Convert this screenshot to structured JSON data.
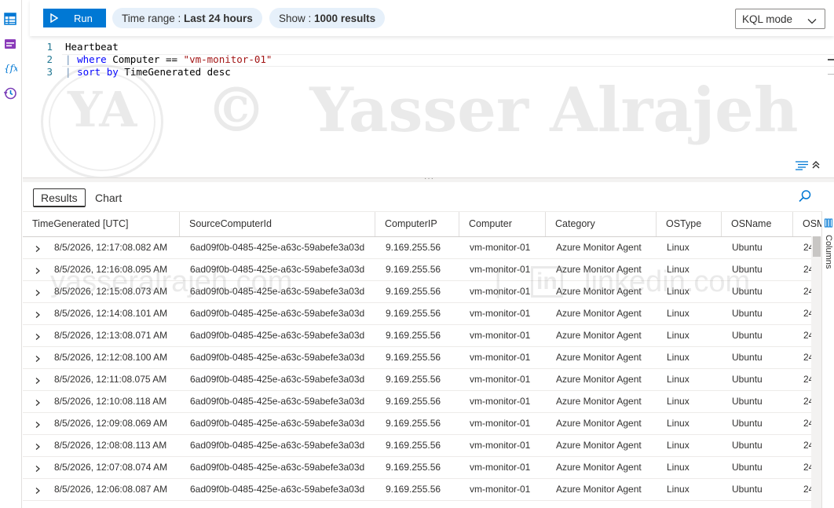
{
  "toolbar": {
    "run_label": "Run",
    "time_range_label": "Time range : ",
    "time_range_value": "Last 24 hours",
    "show_label": "Show : ",
    "show_value": "1000 results",
    "mode_label": "KQL mode"
  },
  "editor": {
    "lines": [
      {
        "num": "1",
        "text": "Heartbeat"
      },
      {
        "num": "2",
        "bar": "|",
        "kw": "where",
        "mid": " Computer == ",
        "str": "\"vm-monitor-01\""
      },
      {
        "num": "3",
        "bar": "|",
        "kw": "sort",
        "mid": " ",
        "kw2": "by",
        "rest": " TimeGenerated desc"
      }
    ]
  },
  "watermark": {
    "monogram": "YA",
    "text": "©  Yasser Alrajeh",
    "site": "yasseralrajeh.com",
    "linkedin": "linkedin.com",
    "in": "in"
  },
  "results": {
    "tabs": [
      "Results",
      "Chart"
    ],
    "columns_label": "Columns",
    "columns": [
      "TimeGenerated [UTC]",
      "SourceComputerId",
      "ComputerIP",
      "Computer",
      "Category",
      "OSType",
      "OSName",
      "OSM"
    ],
    "rows": [
      [
        "8/5/2026, 12:17:08.082 AM",
        "6ad09f0b-0485-425e-a63c-59abefe3a03d",
        "9.169.255.56",
        "vm-monitor-01",
        "Azure Monitor Agent",
        "Linux",
        "Ubuntu",
        "24"
      ],
      [
        "8/5/2026, 12:16:08.095 AM",
        "6ad09f0b-0485-425e-a63c-59abefe3a03d",
        "9.169.255.56",
        "vm-monitor-01",
        "Azure Monitor Agent",
        "Linux",
        "Ubuntu",
        "24"
      ],
      [
        "8/5/2026, 12:15:08.073 AM",
        "6ad09f0b-0485-425e-a63c-59abefe3a03d",
        "9.169.255.56",
        "vm-monitor-01",
        "Azure Monitor Agent",
        "Linux",
        "Ubuntu",
        "24"
      ],
      [
        "8/5/2026, 12:14:08.101 AM",
        "6ad09f0b-0485-425e-a63c-59abefe3a03d",
        "9.169.255.56",
        "vm-monitor-01",
        "Azure Monitor Agent",
        "Linux",
        "Ubuntu",
        "24"
      ],
      [
        "8/5/2026, 12:13:08.071 AM",
        "6ad09f0b-0485-425e-a63c-59abefe3a03d",
        "9.169.255.56",
        "vm-monitor-01",
        "Azure Monitor Agent",
        "Linux",
        "Ubuntu",
        "24"
      ],
      [
        "8/5/2026, 12:12:08.100 AM",
        "6ad09f0b-0485-425e-a63c-59abefe3a03d",
        "9.169.255.56",
        "vm-monitor-01",
        "Azure Monitor Agent",
        "Linux",
        "Ubuntu",
        "24"
      ],
      [
        "8/5/2026, 12:11:08.075 AM",
        "6ad09f0b-0485-425e-a63c-59abefe3a03d",
        "9.169.255.56",
        "vm-monitor-01",
        "Azure Monitor Agent",
        "Linux",
        "Ubuntu",
        "24"
      ],
      [
        "8/5/2026, 12:10:08.118 AM",
        "6ad09f0b-0485-425e-a63c-59abefe3a03d",
        "9.169.255.56",
        "vm-monitor-01",
        "Azure Monitor Agent",
        "Linux",
        "Ubuntu",
        "24"
      ],
      [
        "8/5/2026, 12:09:08.069 AM",
        "6ad09f0b-0485-425e-a63c-59abefe3a03d",
        "9.169.255.56",
        "vm-monitor-01",
        "Azure Monitor Agent",
        "Linux",
        "Ubuntu",
        "24"
      ],
      [
        "8/5/2026, 12:08:08.113 AM",
        "6ad09f0b-0485-425e-a63c-59abefe3a03d",
        "9.169.255.56",
        "vm-monitor-01",
        "Azure Monitor Agent",
        "Linux",
        "Ubuntu",
        "24"
      ],
      [
        "8/5/2026, 12:07:08.074 AM",
        "6ad09f0b-0485-425e-a63c-59abefe3a03d",
        "9.169.255.56",
        "vm-monitor-01",
        "Azure Monitor Agent",
        "Linux",
        "Ubuntu",
        "24"
      ],
      [
        "8/5/2026, 12:06:08.087 AM",
        "6ad09f0b-0485-425e-a63c-59abefe3a03d",
        "9.169.255.56",
        "vm-monitor-01",
        "Azure Monitor Agent",
        "Linux",
        "Ubuntu",
        "24"
      ]
    ]
  },
  "colors": {
    "accent": "#0078d4",
    "pill_bg": "#e6f0fa",
    "keyword": "#0000ff",
    "string": "#a31515",
    "rail_icon": "#0078d4",
    "rail_icon_alt": "#7b3fb8"
  }
}
